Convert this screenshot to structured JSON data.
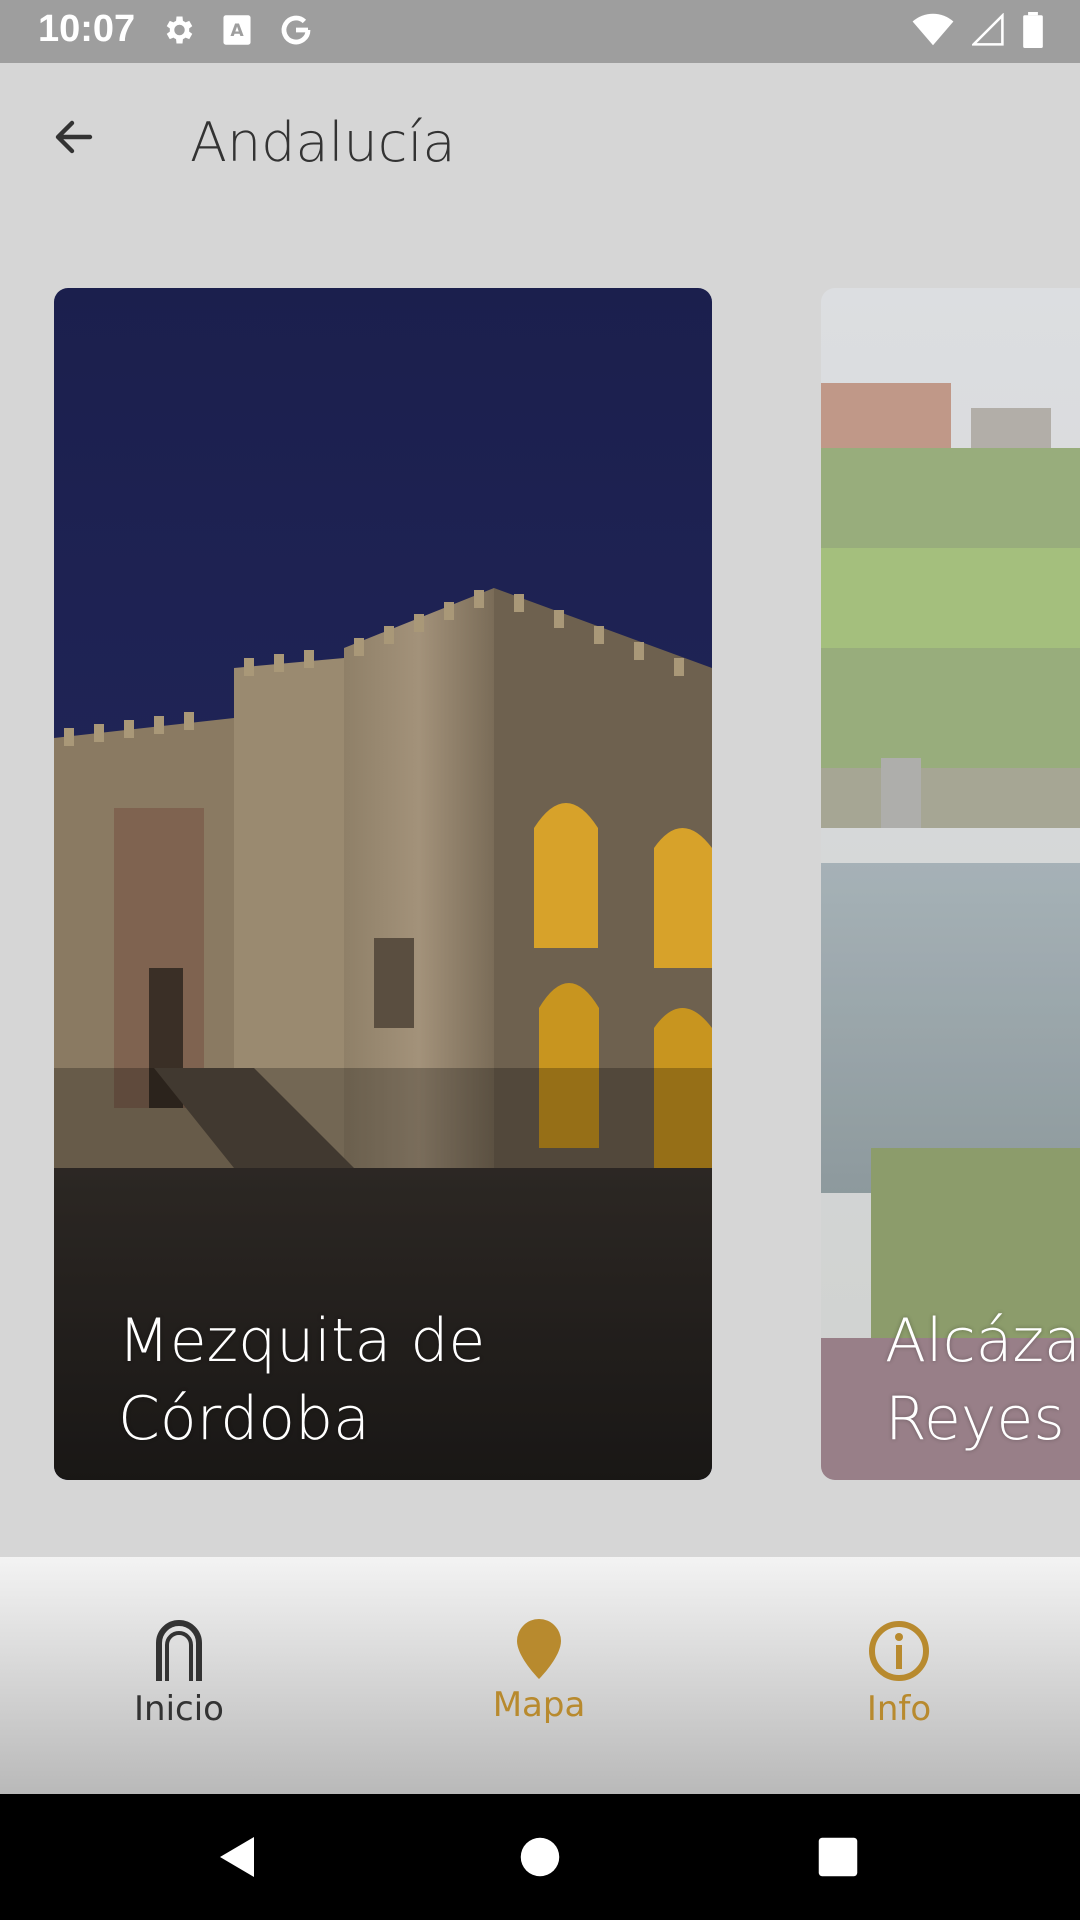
{
  "status_bar": {
    "time": "10:07",
    "icons_left": [
      "gear-icon",
      "text-a-icon",
      "google-g-icon"
    ],
    "icons_right": [
      "wifi-icon",
      "signal-icon",
      "battery-icon"
    ]
  },
  "app_bar": {
    "title": "Andalucía",
    "back_icon": "arrow-back-icon"
  },
  "cards": [
    {
      "label_line1": "Mezquita de",
      "label_line2": "Córdoba"
    },
    {
      "label_line1": "Alcáza",
      "label_line2": "Reyes"
    }
  ],
  "bottom_nav": {
    "items": [
      {
        "label": "Inicio",
        "icon": "arch-icon",
        "color": "#333333"
      },
      {
        "label": "Mapa",
        "icon": "map-pin-icon",
        "color": "#b88a2e"
      },
      {
        "label": "Info",
        "icon": "info-circle-icon",
        "color": "#b88a2e"
      }
    ]
  },
  "system_nav": [
    "back-triangle-icon",
    "home-circle-icon",
    "recents-square-icon"
  ]
}
